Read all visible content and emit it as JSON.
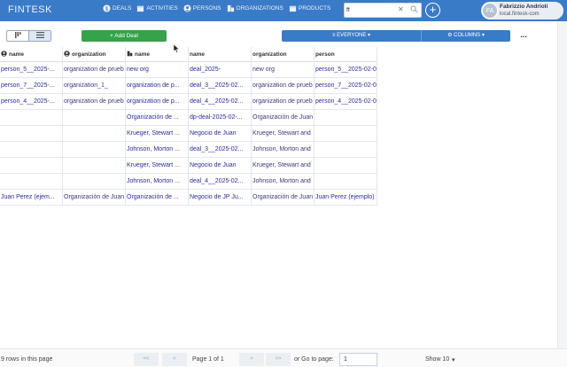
{
  "app": {
    "brand": "FINTESK"
  },
  "nav": [
    {
      "label": "DEALS",
      "icon": "dollar-icon"
    },
    {
      "label": "ACTIVITIES",
      "icon": "calendar-icon"
    },
    {
      "label": "PERSONS",
      "icon": "person-icon"
    },
    {
      "label": "ORGANIZATIONS",
      "icon": "building-icon"
    },
    {
      "label": "PRODUCTS",
      "icon": "box-icon"
    }
  ],
  "search": {
    "value": "ff",
    "placeholder": ""
  },
  "user": {
    "initials": "FA",
    "name": "Fabrizzio Andrioli",
    "host": "local.fintesk-com"
  },
  "toolbar": {
    "add_label": "+ Add Deal",
    "filter_label": "EVERYONE",
    "columns_label": "COLUMNS",
    "more_label": "..."
  },
  "colors": {
    "header": "#3a7bc8",
    "add": "#36a24a",
    "link": "#2c2c9a"
  },
  "table": {
    "headers": [
      {
        "label": "name",
        "icon": "person-icon"
      },
      {
        "label": "organization",
        "icon": "person-icon"
      },
      {
        "label": "name",
        "icon": "building-icon"
      },
      {
        "label": "name",
        "icon": ""
      },
      {
        "label": "organization",
        "icon": ""
      },
      {
        "label": "person",
        "icon": ""
      }
    ],
    "rows": [
      [
        "person_5__2025-...",
        "organization de prueb",
        "new org",
        "deal_2025-",
        "new org",
        "person_5__2025-02-0"
      ],
      [
        "person_7__2025-...",
        "organization_1_",
        "organization de p...",
        "deal_3__2025-02...",
        "organization de prueb",
        "person_7__2025-02-0"
      ],
      [
        "person_4__2025-...",
        "organization de prueb",
        "organization de p...",
        "deal_4__2025-02...",
        "organization de prueb",
        "person_4__2025-02-0"
      ],
      [
        "",
        "",
        "Organización de ...",
        "dp-deal-2025-02-...",
        "Organización de Juan",
        ""
      ],
      [
        "",
        "",
        "Krueger, Stewart ...",
        "Negocio de Juan",
        "Krueger, Stewart and",
        ""
      ],
      [
        "",
        "",
        "Johnson, Morton ...",
        "deal_3__2025-02...",
        "Johnson, Morton and",
        ""
      ],
      [
        "",
        "",
        "Krueger, Stewart ...",
        "Negocio de Juan",
        "Krueger, Stewart and",
        ""
      ],
      [
        "",
        "",
        "Johnson, Morton ...",
        "deal_4__2025-02...",
        "Johnson, Morton and",
        ""
      ],
      [
        "Juan Perez (ejem...",
        "Organización de Juan",
        "Organización de ...",
        "Negocio de JP Ju...",
        "Organización de Juan",
        "Juan Perez (ejemplo)"
      ]
    ]
  },
  "footer": {
    "rows_text": "9 rows in this page",
    "first": "<<",
    "prev": "<",
    "page_info": "Page 1 of 1",
    "next": ">",
    "last": ">>",
    "goto_label": "or Go to page:",
    "goto_value": "1",
    "show_label": "Show 10"
  }
}
